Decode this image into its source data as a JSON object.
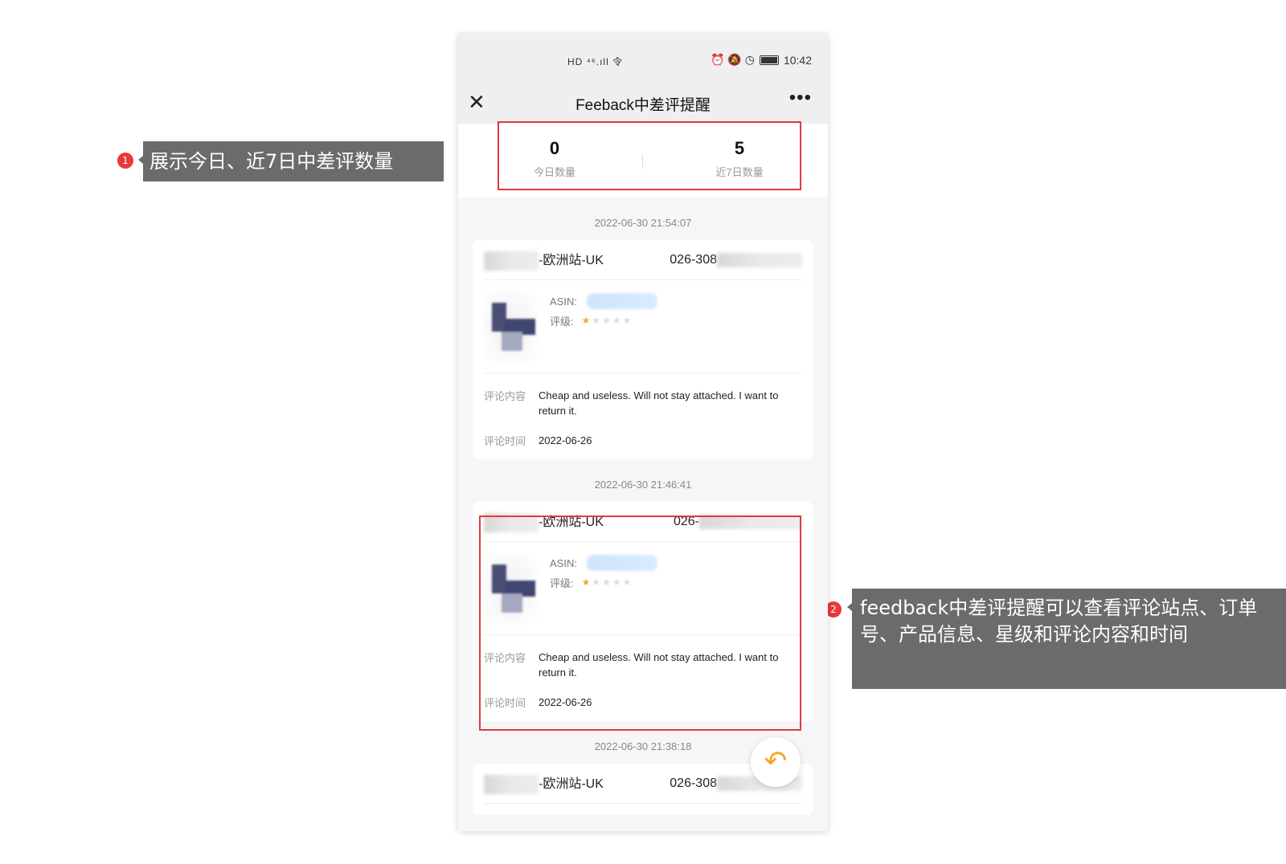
{
  "annotations": [
    {
      "num": "1",
      "text": "展示今日、近7日中差评数量"
    },
    {
      "num": "2",
      "text": "feedback中差评提醒可以查看评论站点、订单号、产品信息、星级和评论内容和时间"
    }
  ],
  "status_bar": {
    "network": "HD ⁴⁶.ıll 令",
    "icons": "⏰ 🔕 ◷",
    "time": "10:42"
  },
  "header": {
    "title": "Feeback中差评提醒",
    "close_icon": "close-icon",
    "more_icon": "more-icon"
  },
  "summary": {
    "today_value": "0",
    "today_label": "今日数量",
    "week_value": "5",
    "week_label": "近7日数量"
  },
  "reviews": [
    {
      "time": "2022-06-30 21:54:07",
      "store": "-欧洲站-UK",
      "order": "026-308",
      "asin_label": "ASIN:",
      "rating_label": "评级:",
      "rating": 1,
      "content_label": "评论内容",
      "content": "Cheap and useless. Will not stay attached. I want to return it.",
      "date_label": "评论时间",
      "date": "2022-06-26"
    },
    {
      "time": "2022-06-30 21:46:41",
      "store": "-欧洲站-UK",
      "order": "026-",
      "asin_label": "ASIN:",
      "rating_label": "评级:",
      "rating": 1,
      "content_label": "评论内容",
      "content": "Cheap and useless. Will not stay attached. I want to return it.",
      "date_label": "评论时间",
      "date": "2022-06-26"
    },
    {
      "time": "2022-06-30 21:38:18",
      "store": "-欧洲站-UK",
      "order": "026-308"
    }
  ],
  "fab": {
    "icon": "reply-icon"
  },
  "colors": {
    "accent": "#f5a623",
    "highlight": "#e23a3a",
    "annotation_bg": "#6b6b6b"
  }
}
